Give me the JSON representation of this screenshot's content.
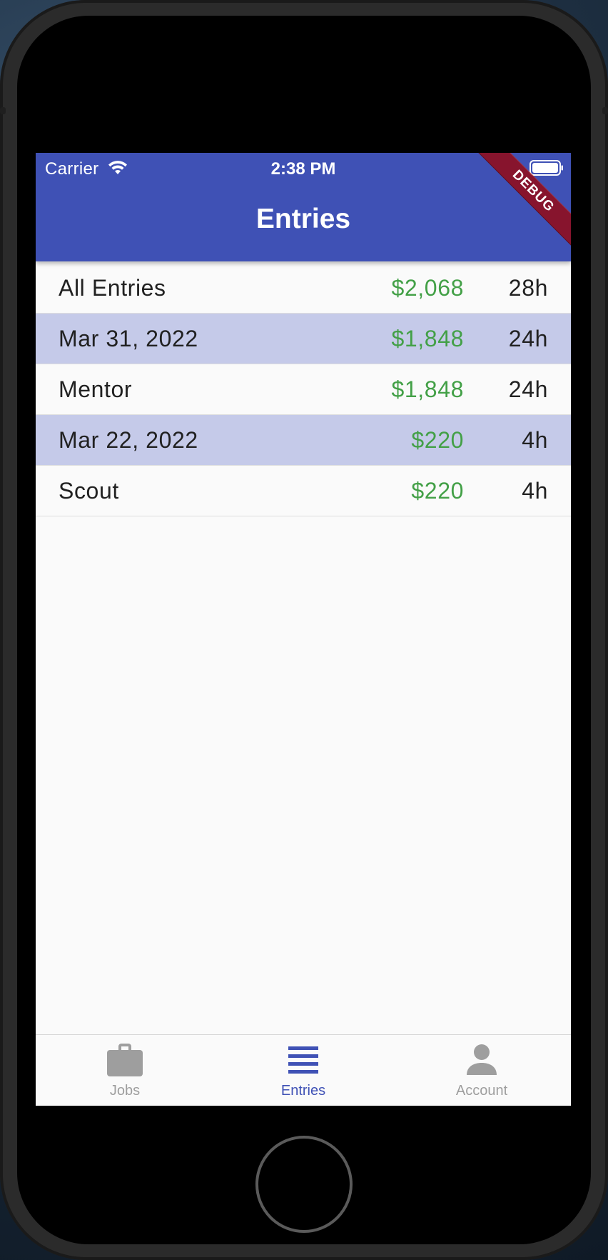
{
  "status_bar": {
    "carrier": "Carrier",
    "time": "2:38 PM",
    "wifi_icon": "wifi-icon",
    "battery_icon": "battery-icon"
  },
  "app_bar": {
    "title": "Entries",
    "debug_banner": "DEBUG",
    "background": "#3f51b5"
  },
  "entries": [
    {
      "label": "All Entries",
      "amount": "$2,068",
      "hours": "28h",
      "highlighted": false
    },
    {
      "label": "Mar 31, 2022",
      "amount": "$1,848",
      "hours": "24h",
      "highlighted": true
    },
    {
      "label": "Mentor",
      "amount": "$1,848",
      "hours": "24h",
      "highlighted": false
    },
    {
      "label": "Mar 22, 2022",
      "amount": "$220",
      "hours": "4h",
      "highlighted": true
    },
    {
      "label": "Scout",
      "amount": "$220",
      "hours": "4h",
      "highlighted": false
    }
  ],
  "colors": {
    "amount": "#43a047",
    "highlight_row": "#c5cae9",
    "active_tab": "#3f51b5",
    "inactive_tab": "#9e9e9e"
  },
  "bottom_nav": [
    {
      "label": "Jobs",
      "icon": "briefcase-icon",
      "active": false
    },
    {
      "label": "Entries",
      "icon": "list-icon",
      "active": true
    },
    {
      "label": "Account",
      "icon": "person-icon",
      "active": false
    }
  ]
}
